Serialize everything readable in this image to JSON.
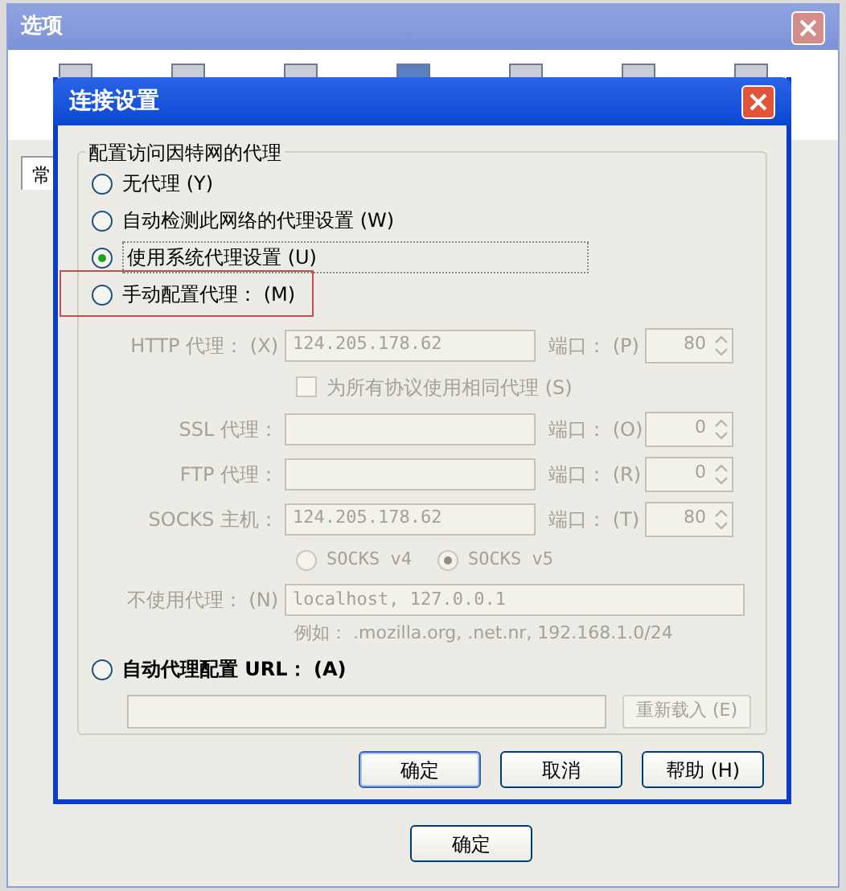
{
  "window": {
    "title": "选项",
    "tab": "常"
  },
  "dialog": {
    "title": "连接设置",
    "group_title": "配置访问因特网的代理",
    "proxy_modes": [
      {
        "label": "无代理 (Y)",
        "selected": false,
        "highlighted": false
      },
      {
        "label": "自动检测此网络的代理设置 (W)",
        "selected": false,
        "highlighted": false
      },
      {
        "label": "使用系统代理设置 (U)",
        "selected": true,
        "highlighted": false
      },
      {
        "label": "手动配置代理： (M)",
        "selected": false,
        "highlighted": true
      }
    ],
    "proxies": [
      {
        "label": "HTTP 代理： (X)",
        "value": "124.205.178.62",
        "port_label": "端口： (P)",
        "port": "80"
      },
      {
        "label": "SSL 代理：",
        "port_label": "端口： (O)",
        "port": "0"
      },
      {
        "label": "FTP 代理：",
        "port_label": "端口： (R)",
        "port": "0"
      },
      {
        "label": "SOCKS 主机：",
        "value": "124.205.178.62",
        "port_label": "端口： (T)",
        "port": "80"
      }
    ],
    "same_proxy": {
      "label": "为所有协议使用相同代理 (S)",
      "checked": false
    },
    "socks_versions": [
      {
        "label": "SOCKS v4",
        "selected": false
      },
      {
        "label": "SOCKS v5",
        "selected": true
      }
    ],
    "no_proxy": {
      "label": "不使用代理： (N)",
      "value": "localhost, 127.0.0.1",
      "example": "例如： .mozilla.org, .net.nr, 192.168.1.0/24"
    },
    "auto_config": {
      "label": "自动代理配置 URL： (A)",
      "selected": false,
      "reload_button": "重新载入 (E)"
    },
    "buttons": [
      "确定",
      "取消",
      "帮助 (H)"
    ]
  },
  "main_buttons": [
    "确定"
  ]
}
